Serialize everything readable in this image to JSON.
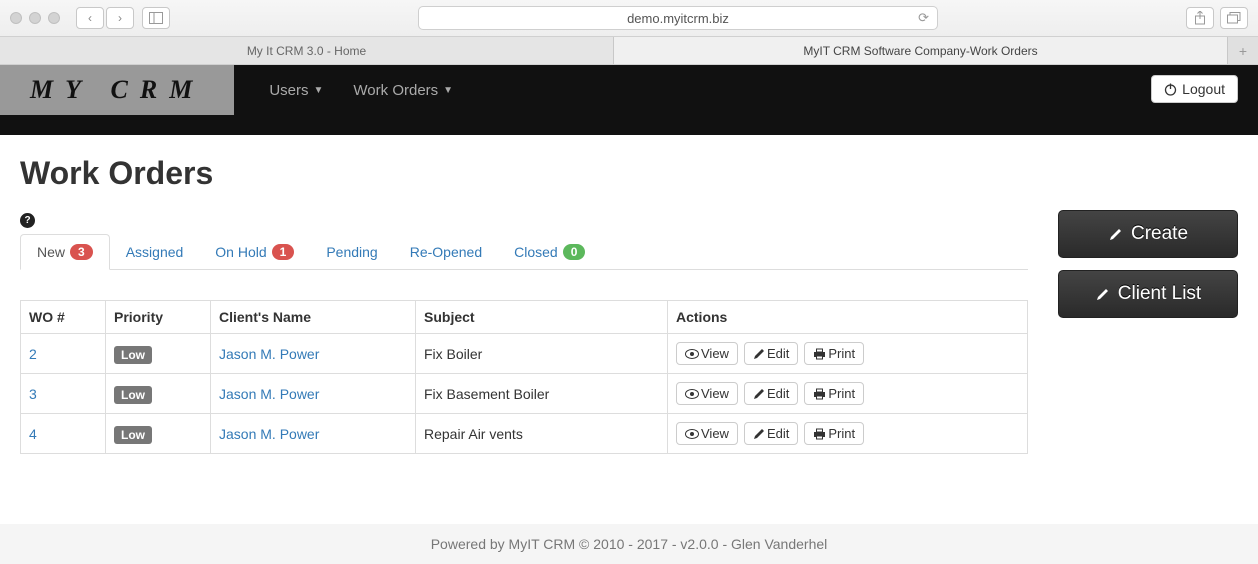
{
  "browser": {
    "url": "demo.myitcrm.biz",
    "tabs": [
      {
        "title": "My It CRM 3.0 - Home",
        "active": false
      },
      {
        "title": "MyIT CRM Software Company-Work Orders",
        "active": true
      }
    ]
  },
  "navbar": {
    "brand": "MY CRM",
    "menu": [
      {
        "label": "Users"
      },
      {
        "label": "Work Orders"
      }
    ],
    "logout": "Logout"
  },
  "page": {
    "title": "Work Orders"
  },
  "tabs": [
    {
      "label": "New",
      "count": "3",
      "badge_class": "badge-red",
      "active": true
    },
    {
      "label": "Assigned",
      "count": null
    },
    {
      "label": "On Hold",
      "count": "1",
      "badge_class": "badge-red"
    },
    {
      "label": "Pending",
      "count": null
    },
    {
      "label": "Re-Opened",
      "count": null
    },
    {
      "label": "Closed",
      "count": "0",
      "badge_class": "badge-green"
    }
  ],
  "table": {
    "headers": {
      "wo": "WO #",
      "priority": "Priority",
      "client": "Client's Name",
      "subject": "Subject",
      "actions": "Actions"
    },
    "rows": [
      {
        "wo": "2",
        "priority": "Low",
        "client": "Jason M. Power",
        "subject": "Fix Boiler"
      },
      {
        "wo": "3",
        "priority": "Low",
        "client": "Jason M. Power",
        "subject": "Fix Basement Boiler"
      },
      {
        "wo": "4",
        "priority": "Low",
        "client": "Jason M. Power",
        "subject": "Repair Air vents"
      }
    ],
    "actions": {
      "view": "View",
      "edit": "Edit",
      "print": "Print"
    }
  },
  "side": {
    "create": "Create",
    "client_list": "Client List"
  },
  "footer": "Powered by MyIT CRM © 2010 - 2017 - v2.0.0 - Glen Vanderhel"
}
